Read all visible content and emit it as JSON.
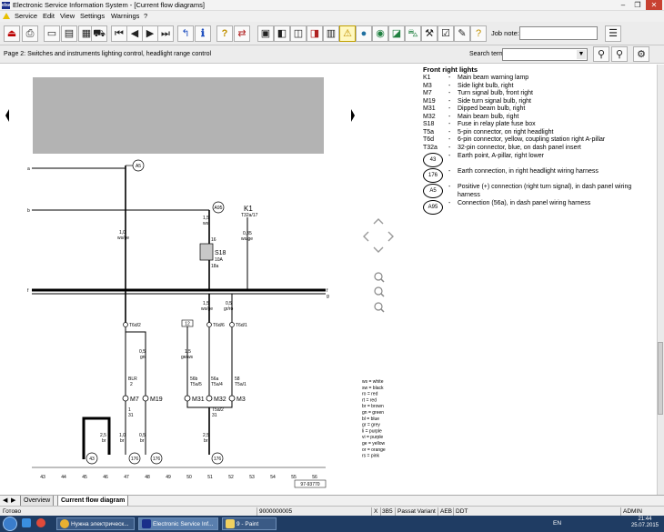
{
  "window": {
    "title": "Electronic Service Information System - [Current flow diagrams]",
    "app_icon_text": "elsa",
    "minimize": "–",
    "maximize": "❐",
    "close": "✕"
  },
  "menu": [
    "Service",
    "Edit",
    "View",
    "Settings",
    "Warnings",
    "?"
  ],
  "toolbar": {
    "job_note_label": "Job note:"
  },
  "page_bar": {
    "page_label": "Page 2: Switches and instruments lighting control, headlight range control",
    "search_label": "Search term:",
    "search_value": ""
  },
  "legend": {
    "title": "Front right lights",
    "items": [
      {
        "code": "K1",
        "desc": "Main beam warning lamp"
      },
      {
        "code": "M3",
        "desc": "Side light bulb, right"
      },
      {
        "code": "M7",
        "desc": "Turn signal bulb, front right"
      },
      {
        "code": "M19",
        "desc": "Side turn signal bulb, right"
      },
      {
        "code": "M31",
        "desc": "Dipped beam bulb, right"
      },
      {
        "code": "M32",
        "desc": "Main beam bulb, right"
      },
      {
        "code": "S18",
        "desc": "Fuse in relay plate fuse box"
      },
      {
        "code": "T5a",
        "desc": "5-pin connector, on right headlight"
      },
      {
        "code": "T6d",
        "desc": "6-pin connector, yellow, coupling station right A-pillar"
      },
      {
        "code": "T32a",
        "desc": "32-pin connector, blue, on dash panel insert"
      }
    ],
    "circles": [
      {
        "code": "43",
        "desc": "Earth point, A-pillar, right lower"
      },
      {
        "code": "176",
        "desc": "Earth connection, in right headlight wiring harness"
      },
      {
        "code": "A5",
        "desc": "Positive (+) connection (right turn signal), in dash panel wiring harness"
      },
      {
        "code": "A95",
        "desc": "Connection (56a), in dash panel wiring harness"
      }
    ],
    "dash": "-"
  },
  "colour_codes": [
    "ws = white",
    "sw = black",
    "ro = red",
    "rt = red",
    "br = brown",
    "gn = green",
    "bl = blue",
    "gr = grey",
    "li = purple",
    "vi = purple",
    "ge = yellow",
    "or = orange",
    "rs = pink"
  ],
  "diagram": {
    "rails": [
      "a",
      "b",
      "f",
      "g"
    ],
    "a5": "A5",
    "a95": "A95",
    "k1": "K1",
    "t32a_17": "T32a/17",
    "s18": "S18",
    "s18_amp": "10A",
    "s18_pin": "16",
    "s18_pin2": "18a",
    "w_10_wsge": [
      "1,0",
      "ws/ge"
    ],
    "w_15_ws": [
      "1,5",
      "ws"
    ],
    "w_035_wsge": [
      "0,35",
      "ws/ge"
    ],
    "w_15_wsge": [
      "1,5",
      "ws/ge"
    ],
    "w_05_grro": [
      "0,5",
      "gr/ro"
    ],
    "t6d2": "T6d/2",
    "t6d6": "T6d/6",
    "t6d1": "T6d/1",
    "w_05_gn": [
      "0,5",
      "gn"
    ],
    "ref_12": "12",
    "w_15_gews": [
      "1,5",
      "ge/ws"
    ],
    "blr": [
      "BLR",
      "2"
    ],
    "p56b": [
      "56b",
      "T5a/5"
    ],
    "p56a": [
      "56a",
      "T5a/4"
    ],
    "p58": [
      "58",
      "T5a/1"
    ],
    "m7": "M7",
    "m19": "M19",
    "m31": "M31",
    "m32": "M32",
    "m3": "M3",
    "pin_1_31": [
      "1",
      "31"
    ],
    "t5a2": [
      "T5a/2",
      "31"
    ],
    "w_10_br": [
      "1,0",
      "br"
    ],
    "w_05_br": [
      "0,5",
      "br"
    ],
    "w_25_br_a": [
      "2,5",
      "br"
    ],
    "w_25_br_b": [
      "2,5",
      "br"
    ],
    "earth_43": "43",
    "earth_176": "176",
    "columns": [
      "43",
      "44",
      "45",
      "46",
      "47",
      "48",
      "49",
      "50",
      "51",
      "52",
      "53",
      "54",
      "55",
      "56"
    ],
    "ref_number": "97-93770"
  },
  "tabs": [
    "Overview",
    "Current flow diagram"
  ],
  "statusbar": {
    "ready": "Готово",
    "id": "9000000005",
    "x": "X",
    "engine": "3B5",
    "model": "Passat Variant",
    "aeb": "AEB",
    "ddt": "DDT",
    "admin": "ADMIN"
  },
  "taskbar": {
    "items": [
      "Нужна электрическ...",
      "Electronic Service Inf...",
      "9 - Paint"
    ],
    "lang": "EN",
    "time": "21:44",
    "date": "25.07.2015"
  }
}
